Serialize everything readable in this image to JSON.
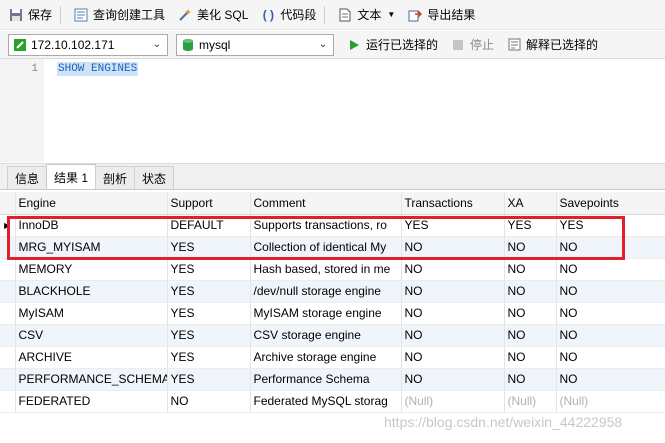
{
  "toolbar": {
    "save": "保存",
    "query_builder": "查询创建工具",
    "beautify": "美化 SQL",
    "snippet": "代码段",
    "text": "文本",
    "export": "导出结果"
  },
  "connection_bar": {
    "host": "172.10.102.171",
    "database": "mysql",
    "run_selected": "运行已选择的",
    "stop": "停止",
    "explain_selected": "解释已选择的"
  },
  "editor": {
    "line_number": "1",
    "code": "SHOW ENGINES"
  },
  "result_tabs": [
    "信息",
    "结果 1",
    "剖析",
    "状态"
  ],
  "results": {
    "columns": [
      "Engine",
      "Support",
      "Comment",
      "Transactions",
      "XA",
      "Savepoints"
    ],
    "rows": [
      [
        "InnoDB",
        "DEFAULT",
        "Supports transactions, ro",
        "YES",
        "YES",
        "YES"
      ],
      [
        "MRG_MYISAM",
        "YES",
        "Collection of identical My",
        "NO",
        "NO",
        "NO"
      ],
      [
        "MEMORY",
        "YES",
        "Hash based, stored in me",
        "NO",
        "NO",
        "NO"
      ],
      [
        "BLACKHOLE",
        "YES",
        "/dev/null storage engine",
        "NO",
        "NO",
        "NO"
      ],
      [
        "MyISAM",
        "YES",
        "MyISAM storage engine",
        "NO",
        "NO",
        "NO"
      ],
      [
        "CSV",
        "YES",
        "CSV storage engine",
        "NO",
        "NO",
        "NO"
      ],
      [
        "ARCHIVE",
        "YES",
        "Archive storage engine",
        "NO",
        "NO",
        "NO"
      ],
      [
        "PERFORMANCE_SCHEMA",
        "YES",
        "Performance Schema",
        "NO",
        "NO",
        "NO"
      ],
      [
        "FEDERATED",
        "NO",
        "Federated MySQL storag",
        "(Null)",
        "(Null)",
        "(Null)"
      ]
    ]
  },
  "watermark": "https://blog.csdn.net/weixin_44222958",
  "colors": {
    "highlight": "#e0202a",
    "run": "#2aa12a",
    "db_icon": "#2e9e3e"
  }
}
